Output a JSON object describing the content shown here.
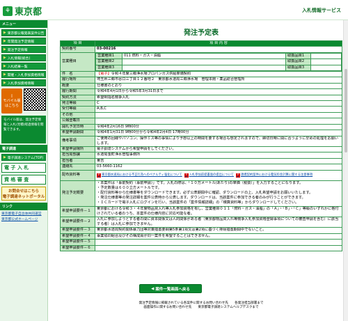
{
  "header": {
    "logo_text": "東京都",
    "logo_icon": "tokyo-logo-icon",
    "site_name": "入札情報サービス"
  },
  "sidebar": {
    "menu_head": "メニュー",
    "items": [
      "東京都公報発表案件公告",
      "年間発注予定情報",
      "発注予定情報",
      "入札情報(総合)",
      "入札結果一覧",
      "開催・入札参加資格情報",
      "入札参加資格情報"
    ],
    "mobile_label": "モバイル版",
    "mobile_sub": "はこちら",
    "note": "モバイル版は、発注予定情報と入札(見積)経過情報を閲覧できます。",
    "link_head": "電子調達",
    "sys_items": [
      "電子調達システム(TOP)"
    ],
    "big_items": [
      "電 子 入 札",
      "資 格 審 査"
    ],
    "contact_line1": "お問合せはこちら",
    "contact_line2": "電子調達ネットポータル",
    "links_head": "リンク",
    "links": [
      "東京都電子自治体共同運営",
      "東京都公式ホームページ"
    ]
  },
  "page": {
    "title": "発注予定表"
  },
  "table": {
    "h1": "項 目",
    "h2": "項 目 内 容",
    "contract_no_label": "契約番号",
    "contract_no": "03-00216",
    "business_label": "営業種目",
    "business_rows": [
      {
        "kind": "営業種目1",
        "value": "011 燃料・ガス・油脂",
        "sub": "取扱品目1"
      },
      {
        "kind": "営業種目2",
        "value": "",
        "sub": "取扱品目2"
      },
      {
        "kind": "営業種目3",
        "value": "",
        "sub": "取扱品目3"
      }
    ],
    "rows": [
      {
        "label": "件　名",
        "value": "令和４年度三郷浄水場プロパンガス供給単価契約",
        "tag": "【電子】"
      },
      {
        "label": "履行場所",
        "value": "埼玉県三郷市谷口三丁目１２番地２　東京都水道局三郷浄水場　管理本館・薬品総合管理所"
      },
      {
        "label": "概要",
        "value": "仕様書のとおり"
      },
      {
        "label": "履行期間",
        "value": "令和4年4月1日から令和5年3月31日まで"
      },
      {
        "label": "契約方法",
        "value": "希望制指名競争入札"
      },
      {
        "label": "発注等級",
        "value": "C"
      },
      {
        "label": "受付等級",
        "value": "A,B,C"
      },
      {
        "label": "その他",
        "value": ""
      },
      {
        "label": "公報登載日",
        "value": ""
      },
      {
        "label": "開札予定日時",
        "value": "令和4年2月16日 9時00分"
      },
      {
        "label": "希望申請期間",
        "value": "令和4年1月31日 9時00分から令和4年2月4日 17時00分"
      }
    ],
    "remarks_label": "備考事項",
    "remarks": "ご使用の回線やパソコン、操作ミス等の事情により予想以上の時間を要する場合も想定されますので、締切日時に間に合うように早めの処理をお願いします。",
    "rows2": [
      {
        "label": "希望申請場所",
        "value": "電子調達システムから希望申請をしてください。"
      },
      {
        "label": "担当局部課",
        "value": "水道局金町浄水管理事務所"
      },
      {
        "label": "担当者",
        "value": "東吉"
      },
      {
        "label": "連絡先",
        "value": "03-5660-1162"
      }
    ],
    "dist_label": "配布資料等",
    "dist": [
      "東京都水道局における不正行為へのペナルティ強化について",
      "入札参加前提書面の提出について",
      "連携契約案件における電気料金計算に関する注意事項"
    ],
    "conds_label": "発注予定概要",
    "conds": [
      "・本案件は「事前契約（事前申請）」です。入札の際は、「１０万メートル(あたり)の単価（税抜）」を入力することになります。",
      "・予定数量は６００立方メートルです。",
      "・配付資料等から仕様書等をダウンロードできます。必ず公表期間中に確認、ダウンロードの上、入札希望申請をお願いいたします。",
      "・発注仕様書等の発注詳細を案件公表時から公表します。ダウンロードは、当該案件に参加できる者のみが行うことができます。",
      "・ＩＣカードで電子入札にログインを行い、当該案件の「案件情報詳細」の「積算資料等」からダウンロードしてください。"
    ],
    "req_rows": [
      {
        "label": "希望申請要件－１",
        "value": "東京都における令和３・４年度物品買入れ等入札参加資格を有し、営業種目０１１「燃料・ガス・油脂」の「Ａ」・「Ｂ」・「Ｃ」等級のいずれかに格付けされている者のうち、本案件の仕様内容に対応可能な者。"
      },
      {
        "label": "希望申請要件－２",
        "value": "入札に参加しようとする者の間に資本関係又は人的関係がある者（東京都物品買入れ等競争入札参加資格登録事項についての審査申請を含む）に該当する者）は入札に参加できません。"
      },
      {
        "label": "希望申請要件－３",
        "value": "東京都水道局契約関係暴力団等対策措置要綱第5条第1項又は第2項に基づく排除措置期間中でないこと。"
      },
      {
        "label": "希望申請要件－４",
        "value": "事業協同組合及びその構成員が同一案件を希望することはできません。"
      },
      {
        "label": "希望申請要件－５",
        "value": ""
      },
      {
        "label": "希望申請要件－６",
        "value": ""
      }
    ]
  },
  "back_button": "案件一覧画面へ戻る",
  "footer": {
    "line1": "発注予定情報に掲載されている各案件に関するお問い合わせ先　　各発注担当部署まで",
    "line2": "画面操作に関するお問い合わせ先　　東京都電子調達システムヘルプデスクまで"
  }
}
